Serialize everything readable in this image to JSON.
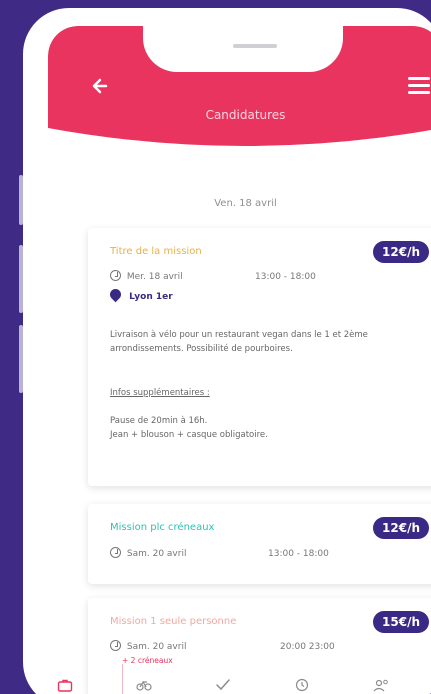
{
  "header": {
    "title": "Candidatures",
    "back_icon": "arrow-left-icon",
    "menu_icon": "hamburger-menu-icon",
    "color": "#e8345f"
  },
  "date_title": "Ven. 18 avril",
  "cards": [
    {
      "title": "Titre de la mission",
      "title_color": "#e6b04a",
      "rate": "12€/h",
      "date": "Mer. 18 avril",
      "time": "13:00 - 18:00",
      "location": "Lyon 1er",
      "description": "Livraison à vélo pour un restaurant vegan dans le 1 et 2ème arrondissements. Possibilité de pourboires.",
      "infos_label": "Infos supplémentaires :",
      "infos_text": "Pause de 20min à 16h.\nJean + blouson + casque obligatoire."
    },
    {
      "title": "Mission plc créneaux",
      "title_color": "#2bc3b3",
      "rate": "12€/h",
      "date": "Sam. 20 avril",
      "time": "13:00 - 18:00"
    },
    {
      "title": "Mission 1 seule personne",
      "title_color": "#f2a9a0",
      "rate": "15€/h",
      "date": "Sam. 20 avril",
      "time": "20:00 23:00",
      "extra": "+ 2 créneaux"
    }
  ],
  "nav": [
    "briefcase-icon",
    "bike-icon",
    "check-icon",
    "history-icon",
    "profile-settings-icon"
  ]
}
